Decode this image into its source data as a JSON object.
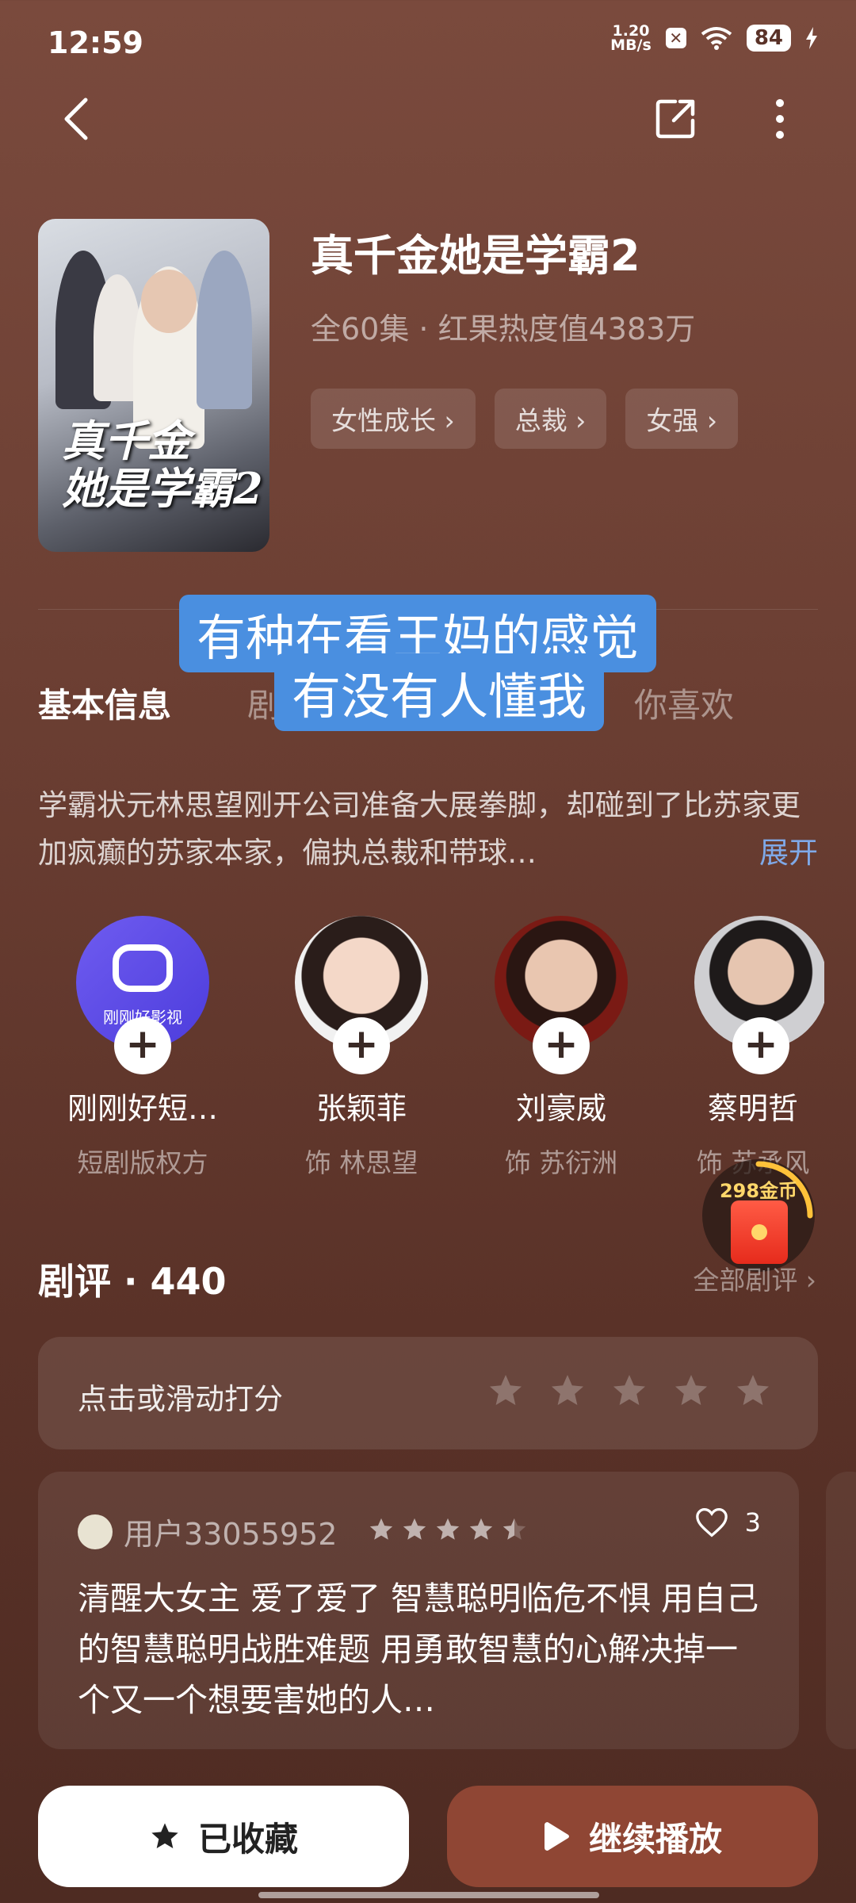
{
  "status": {
    "time": "12:59",
    "netspeed_value": "1.20",
    "netspeed_unit": "MB/s",
    "battery": "84"
  },
  "show": {
    "title": "真千金她是学霸2",
    "meta": "全60集 · 红果热度值4383万",
    "tags": [
      "女性成长 ›",
      "总裁 ›",
      "女强 ›"
    ],
    "poster_title_line1": "真千金",
    "poster_title_line2": "她是学霸2"
  },
  "overlay": {
    "line1": "有种在看王妈的感觉",
    "line2": "有没有人懂我"
  },
  "tabs": {
    "basic": "基本信息",
    "tab2": "剧",
    "tab3": "你喜欢"
  },
  "synopsis": {
    "text": "学霸状元林思望刚开公司准备大展拳脚，却碰到了比苏家更加疯癫的苏家本家，偏执总裁和带球…",
    "expand": "展开"
  },
  "cast": [
    {
      "name": "刚刚好短…",
      "role": "短剧版权方",
      "avatar_text": "刚刚好影视"
    },
    {
      "name": "张颖菲",
      "role": "饰 林思望"
    },
    {
      "name": "刘豪威",
      "role": "饰 苏衍洲"
    },
    {
      "name": "蔡明哲",
      "role": "饰 苏承风"
    }
  ],
  "coin_badge": {
    "label": "298金币"
  },
  "reviews": {
    "title": "剧评 · 440",
    "all_link": "全部剧评 ›",
    "rate_prompt": "点击或滑动打分",
    "items": [
      {
        "user": "用户33055952",
        "rating": 4.5,
        "likes": "3",
        "text": "清醒大女主 爱了爱了 智慧聪明临危不惧 用自己的智慧聪明战胜难题 用勇敢智慧的心解决掉一个又一个想要害她的人…"
      }
    ]
  },
  "actions": {
    "collect": "已收藏",
    "play": "继续播放"
  },
  "colors": {
    "accent_blue": "#7fa9e8",
    "play_button": "#8f4634",
    "subtitle_bg": "#4a8fe0"
  }
}
